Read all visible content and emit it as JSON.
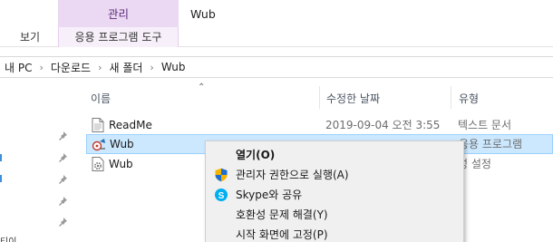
{
  "ribbon": {
    "context_header": "관리",
    "context_tab": "응용 프로그램 도구",
    "view_tab": "보기",
    "window_title": "Wub"
  },
  "address": {
    "crumbs": [
      "내 PC",
      "다운로드",
      "새 폴더",
      "Wub"
    ]
  },
  "columns": {
    "name": "이름",
    "date": "수정한 날짜",
    "type": "유형"
  },
  "files": [
    {
      "name": "ReadMe",
      "date": "2019-09-04 오전 3:55",
      "type": "텍스트 문서",
      "icon": "text-file-icon"
    },
    {
      "name": "Wub",
      "date": "",
      "type": "응용 프로그램",
      "icon": "application-icon",
      "selected": true
    },
    {
      "name": "Wub",
      "date": "",
      "type": "성 설정",
      "icon": "settings-file-icon"
    }
  ],
  "context_menu": {
    "items": [
      {
        "label": "열기(O)",
        "icon": "",
        "bold": true
      },
      {
        "label": "관리자 권한으로 실행(A)",
        "icon": "uac-shield-icon"
      },
      {
        "label": "Skype와 공유",
        "icon": "skype-icon"
      },
      {
        "label": "호환성 문제 해결(Y)",
        "icon": ""
      },
      {
        "label": "시작 화면에 고정(P)",
        "icon": ""
      }
    ]
  },
  "nav": {
    "partial_text": "티이"
  },
  "colors": {
    "context_header_bg": "#ebd8f2",
    "selection_bg": "#cce8ff",
    "selection_border": "#99d1ff",
    "menu_bg": "#f0f0f0"
  }
}
